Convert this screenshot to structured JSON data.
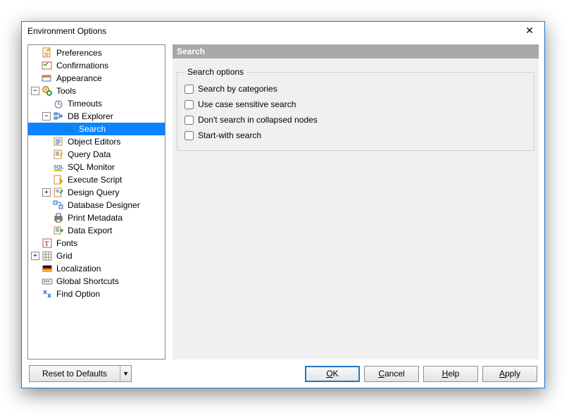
{
  "window": {
    "title": "Environment Options"
  },
  "tree": {
    "preferences": "Preferences",
    "confirmations": "Confirmations",
    "appearance": "Appearance",
    "tools": "Tools",
    "timeouts": "Timeouts",
    "db_explorer": "DB Explorer",
    "search": "Search",
    "object_editors": "Object Editors",
    "query_data": "Query Data",
    "sql_monitor": "SQL Monitor",
    "execute_script": "Execute Script",
    "design_query": "Design Query",
    "database_designer": "Database Designer",
    "print_metadata": "Print Metadata",
    "data_export": "Data Export",
    "fonts": "Fonts",
    "grid": "Grid",
    "localization": "Localization",
    "global_shortcuts": "Global Shortcuts",
    "find_option": "Find Option"
  },
  "panel": {
    "header": "Search",
    "fieldset": "Search options",
    "opt1": "Search by categories",
    "opt2": "Use case sensitive search",
    "opt3": "Don't search in collapsed nodes",
    "opt4": "Start-with search"
  },
  "buttons": {
    "reset": "Reset to Defaults",
    "ok_u": "O",
    "ok_rest": "K",
    "cancel_u": "C",
    "cancel_rest": "ancel",
    "help_u": "H",
    "help_rest": "elp",
    "apply_u": "A",
    "apply_rest": "pply"
  }
}
